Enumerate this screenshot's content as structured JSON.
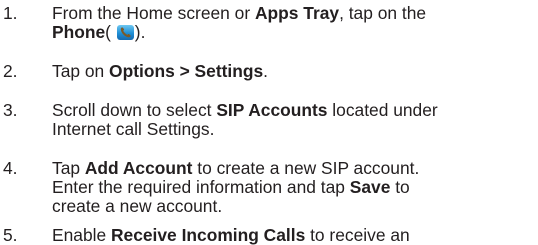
{
  "steps": [
    {
      "number": "1.",
      "line1_pre": "From the Home screen or ",
      "line1_bold": "Apps Tray",
      "line1_post": ", tap on the",
      "line2_bold": "Phone",
      "line2_paren_open": "(",
      "line2_paren_close": ").",
      "icon": "phone-icon"
    },
    {
      "number": "2.",
      "pre": "Tap on ",
      "bold": "Options > Settings",
      "post": "."
    },
    {
      "number": "3.",
      "line1_pre": "Scroll down to select ",
      "line1_bold": "SIP Accounts",
      "line1_post": " located under",
      "line2": "Internet call Settings."
    },
    {
      "number": "4.",
      "line1_pre": "Tap ",
      "line1_bold": "Add Account",
      "line1_post": " to create a new SIP account.",
      "line2_pre": "Enter the required information and tap ",
      "line2_bold": "Save",
      "line2_post": " to",
      "line3": "create a new account."
    },
    {
      "number": "5.",
      "line1_pre": "Enable ",
      "line1_bold": "Receive Incoming Calls",
      "line1_post": " to receive an"
    }
  ]
}
